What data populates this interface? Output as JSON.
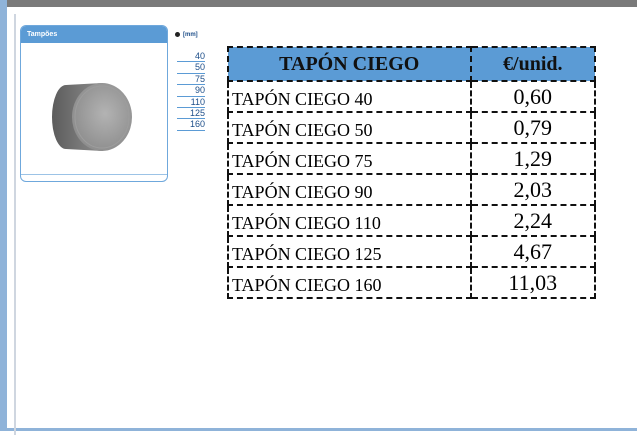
{
  "card": {
    "title": "Tampões",
    "unit_label": "[mm]",
    "sizes": [
      "40",
      "50",
      "75",
      "90",
      "110",
      "125",
      "160"
    ]
  },
  "table": {
    "headers": {
      "name": "TAPÓN CIEGO",
      "price": "€/unid."
    },
    "rows": [
      {
        "name": "TAPÓN CIEGO 40",
        "price": "0,60"
      },
      {
        "name": "TAPÓN CIEGO 50",
        "price": "0,79"
      },
      {
        "name": "TAPÓN CIEGO 75",
        "price": "1,29"
      },
      {
        "name": "TAPÓN CIEGO 90",
        "price": "2,03"
      },
      {
        "name": "TAPÓN CIEGO 110",
        "price": "2,24"
      },
      {
        "name": "TAPÓN CIEGO 125",
        "price": "4,67"
      },
      {
        "name": "TAPÓN CIEGO 160",
        "price": "11,03"
      }
    ]
  },
  "colors": {
    "header_fill": "#5b9bd5",
    "frame_blue": "#8fb3d9",
    "frame_gray": "#7a7a7a"
  }
}
